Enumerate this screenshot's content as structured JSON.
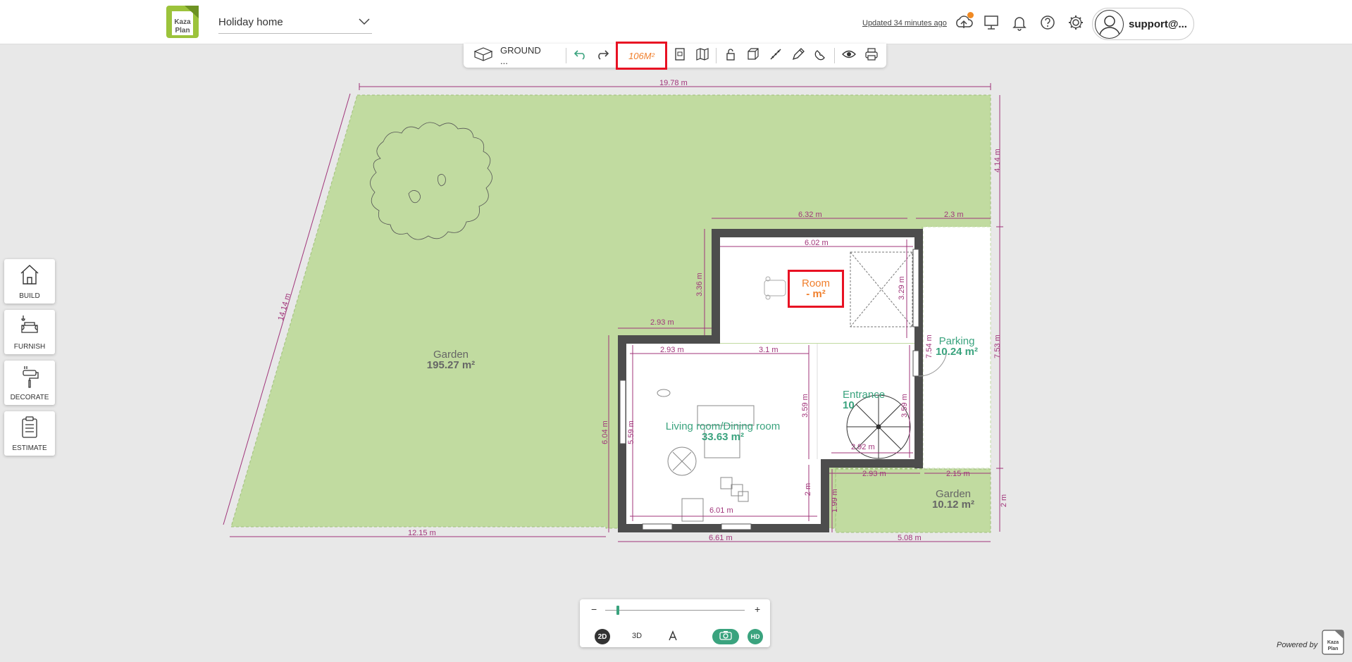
{
  "header": {
    "project_name": "Holiday home",
    "updated_text": "Updated 34 minutes ago",
    "user_name": "support@...",
    "logo_text_1": "Kaza",
    "logo_text_2": "Plan"
  },
  "toolbar": {
    "level_label": "GROUND ...",
    "area_label": "106M²"
  },
  "side_menu": [
    {
      "label": "BUILD"
    },
    {
      "label": "FURNISH"
    },
    {
      "label": "DECORATE"
    },
    {
      "label": "ESTIMATE"
    }
  ],
  "rooms": {
    "garden_main": {
      "name": "Garden",
      "area": "195.27 m²"
    },
    "room": {
      "name": "Room",
      "area": "- m²"
    },
    "parking": {
      "name": "Parking",
      "area": "10.24 m²"
    },
    "entrance": {
      "name": "Entrance",
      "area": "10"
    },
    "living": {
      "name": "Living room/Dining room",
      "area": "33.63 m²"
    },
    "garden_small": {
      "name": "Garden",
      "area": "10.12 m²"
    }
  },
  "dimensions": {
    "top_width": "19.78 m",
    "right_top": "4.14 m",
    "diag_left": "14.14 m",
    "room_outer": "6.32 m",
    "parking_w": "2.3 m",
    "room_inner": "6.02 m",
    "room_h_outer": "3.36 m",
    "room_h_inner": "3.29 m",
    "wall_293_a": "2.93 m",
    "living_293": "2.93 m",
    "living_31": "3.1 m",
    "entrance_h": "7.54 m",
    "right_753": "7.53 m",
    "living_h_outer": "6.04 m",
    "living_h_inner": "5.59 m",
    "living_359": "3.59 m",
    "entrance_359": "3.59 m",
    "entrance_292": "2.92 m",
    "bottom_293": "2.93 m",
    "bottom_215": "2.15 m",
    "living_2m": "2 m",
    "living_601": "6.01 m",
    "small_199": "1.99 m",
    "right_2m": "2 m",
    "bottom_1215": "12.15 m",
    "bottom_661": "6.61 m",
    "bottom_508": "5.08 m"
  },
  "view": {
    "mode_2d": "2D",
    "mode_3d": "3D",
    "hd": "HD",
    "zoom_minus": "−",
    "zoom_plus": "+"
  },
  "footer": {
    "powered_by": "Powered by"
  },
  "colors": {
    "accent": "#3aa37e",
    "orange": "#f07f2c",
    "garden": "#c1dba0",
    "wall": "#4d4d4d",
    "dimension": "#a0347a",
    "highlight": "#e81123"
  }
}
